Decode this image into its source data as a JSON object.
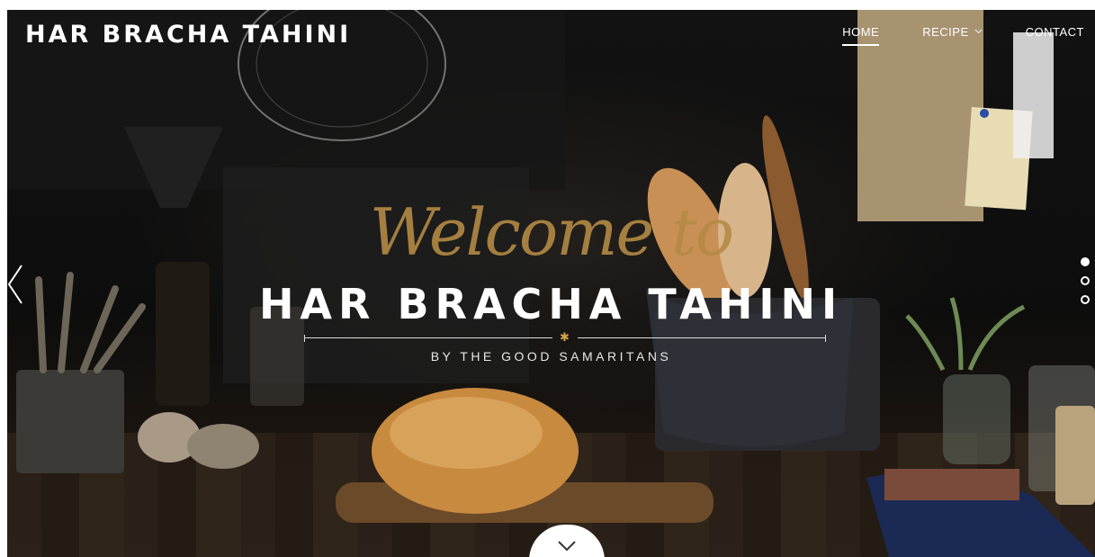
{
  "brand": {
    "logo": "HAR BRACHA TAHINI"
  },
  "nav": {
    "items": [
      {
        "label": "HOME",
        "active": true
      },
      {
        "label": "RECIPE",
        "has_dropdown": true
      },
      {
        "label": "CONTACT"
      }
    ]
  },
  "hero": {
    "script_text": "Welcome to",
    "title": "HAR BRACHA TAHINI",
    "subtitle": "BY THE GOOD SAMARITANS"
  },
  "slider": {
    "prev_icon": "chevron-left-icon",
    "dots": [
      {
        "active": true
      },
      {
        "active": false
      },
      {
        "active": false
      }
    ],
    "scroll_icon": "chevron-down-icon"
  },
  "colors": {
    "accent": "#b48a45",
    "star": "#d4a24a",
    "text": "#ffffff"
  }
}
